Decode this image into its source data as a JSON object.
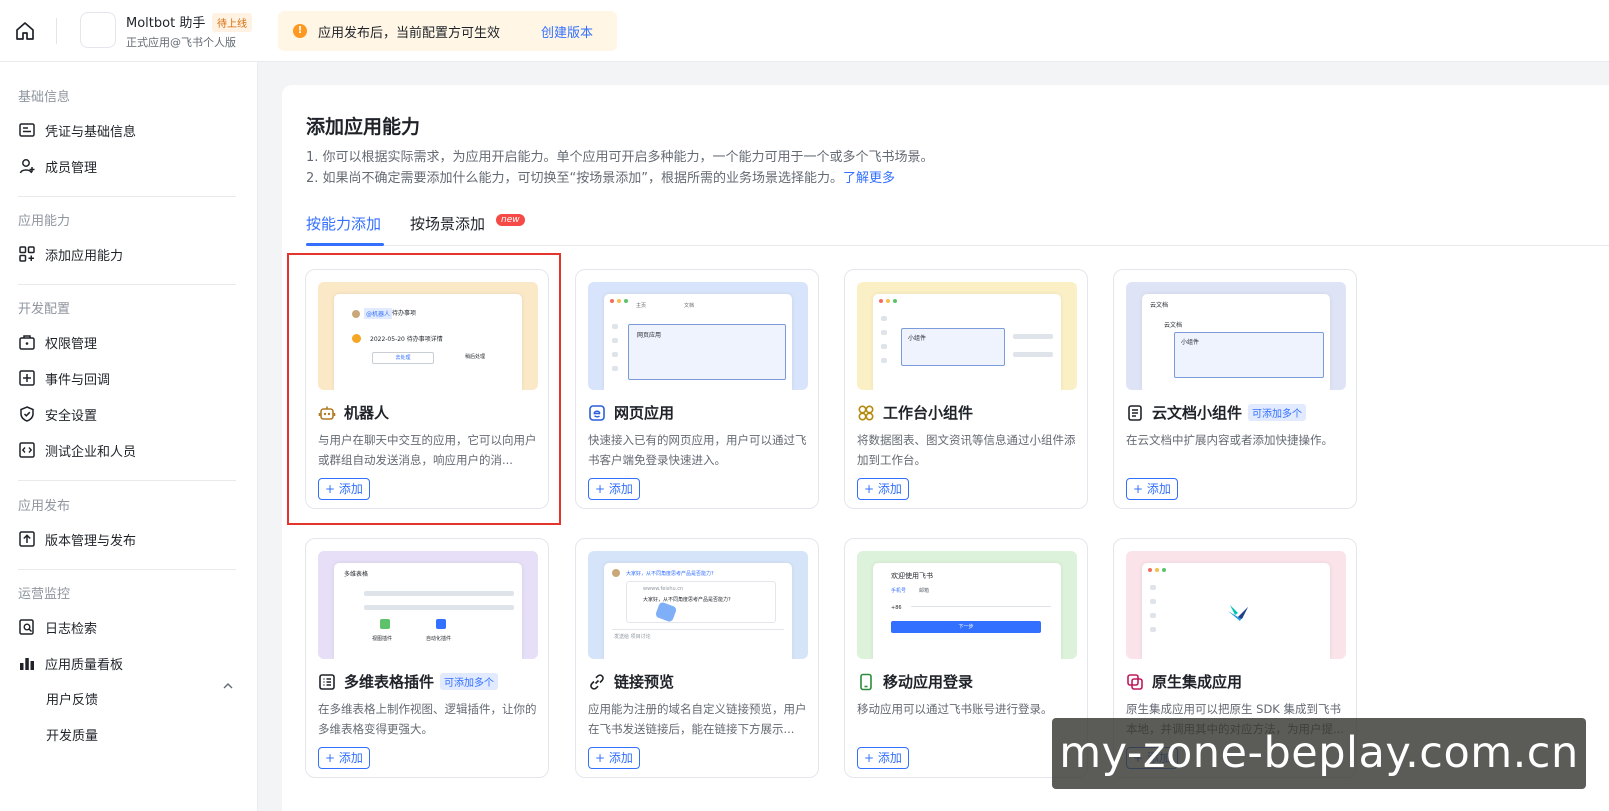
{
  "header": {
    "app_name": "Moltbot 助手",
    "app_status": "待上线",
    "app_subtitle": "正式应用@飞书个人版",
    "notice_text": "应用发布后，当前配置方可生效",
    "notice_link": "创建版本"
  },
  "sidebar": {
    "groups": [
      {
        "label": "基础信息",
        "items": [
          {
            "label": "凭证与基础信息",
            "icon": "credential-icon"
          },
          {
            "label": "成员管理",
            "icon": "member-icon"
          }
        ]
      },
      {
        "label": "应用能力",
        "items": [
          {
            "label": "添加应用能力",
            "icon": "add-capability-icon"
          }
        ]
      },
      {
        "label": "开发配置",
        "items": [
          {
            "label": "权限管理",
            "icon": "permission-icon"
          },
          {
            "label": "事件与回调",
            "icon": "event-icon"
          },
          {
            "label": "安全设置",
            "icon": "shield-icon"
          },
          {
            "label": "测试企业和人员",
            "icon": "code-icon"
          }
        ]
      },
      {
        "label": "应用发布",
        "items": [
          {
            "label": "版本管理与发布",
            "icon": "upload-icon"
          }
        ]
      },
      {
        "label": "运营监控",
        "items": [
          {
            "label": "日志检索",
            "icon": "log-search-icon"
          },
          {
            "label": "应用质量看板",
            "icon": "chart-icon"
          }
        ]
      }
    ],
    "sub_items": [
      "用户反馈",
      "开发质量"
    ]
  },
  "main": {
    "title": "添加应用能力",
    "desc_line1": "1. 你可以根据实际需求，为应用开启能力。单个应用可开启多种能力，一个能力可用于一个或多个飞书场景。",
    "desc_line2": "2. 如果尚不确定需要添加什么能力，可切换至“按场景添加”，根据所需的业务场景选择能力。",
    "learn_more": "了解更多",
    "tabs": [
      {
        "label": "按能力添加"
      },
      {
        "label": "按场景添加"
      }
    ],
    "new_badge": "new",
    "add_label": "+ 添加",
    "multi_label": "可添加多个",
    "cards": [
      {
        "title": "机器人",
        "desc": "与用户在聊天中交互的应用，它可以向用户或群组自动发送消息，响应用户的消...",
        "icon": "robot-icon",
        "color": "#fbe8c6",
        "multi": false
      },
      {
        "title": "网页应用",
        "desc": "快速接入已有的网页应用，用户可以通过飞书客户端免登录快速进入。",
        "icon": "web-app-icon",
        "color": "#d8e4fb",
        "multi": false
      },
      {
        "title": "工作台小组件",
        "desc": "将数据图表、图文资讯等信息通过小组件添加到工作台。",
        "icon": "widget-icon",
        "color": "#fbf0c5",
        "multi": false
      },
      {
        "title": "云文档小组件",
        "desc": "在云文档中扩展内容或者添加快捷操作。",
        "icon": "doc-icon",
        "color": "#dfe3f6",
        "multi": true
      },
      {
        "title": "多维表格插件",
        "desc": "在多维表格上制作视图、逻辑插件，让你的多维表格变得更强大。",
        "icon": "base-table-icon",
        "color": "#e6dff7",
        "multi": true
      },
      {
        "title": "链接预览",
        "desc": "应用能为注册的域名自定义链接预览，用户在飞书发送链接后，能在链接下方展示...",
        "icon": "link-icon",
        "color": "#d6e4fa",
        "multi": false
      },
      {
        "title": "移动应用登录",
        "desc": "移动应用可以通过飞书账号进行登录。",
        "icon": "mobile-icon",
        "color": "#ddf2da",
        "multi": false
      },
      {
        "title": "原生集成应用",
        "desc": "原生集成应用可以把原生 SDK 集成到飞书本地，并调用其中的对应方法，为用户提...",
        "icon": "native-app-icon",
        "color": "#fbe3ea",
        "multi": false
      }
    ],
    "preview_texts": {
      "robot_tag": "@机器人",
      "robot_task": "待办事项",
      "robot_date": "2022-05-20 待办事项详情",
      "robot_btn1": "去处理",
      "robot_btn2": "稍后处理",
      "web_tab1": "主页",
      "web_tab2": "文档",
      "web_frame": "网页应用",
      "widget_label": "小组件",
      "doc_title": "云文档",
      "doc_h": "云文档",
      "doc_widget": "小组件",
      "base_title": "多维表格",
      "base_view": "视图插件",
      "base_auto": "自动化插件",
      "link_msg": "大家好，从不同角度思考产品是否能力?",
      "link_url": "wwww.feishu.cn",
      "link_sub": "大家好，从不同角度思考产品是否能力?",
      "link_input": "发送给 项目讨论",
      "mobile_welcome": "欢迎使用飞书",
      "mobile_tab1": "手机号",
      "mobile_tab2": "邮箱",
      "mobile_code": "+86",
      "mobile_next": "下一步"
    }
  },
  "watermark": "my-zone-beplay.com.cn",
  "colors": {
    "accent": "#3370ff",
    "highlight": "#e5352b"
  }
}
